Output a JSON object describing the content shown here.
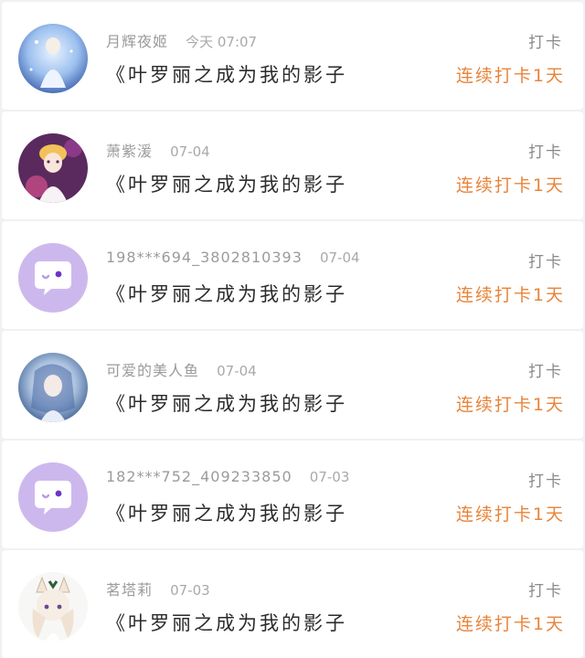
{
  "feed": {
    "items": [
      {
        "username": "月辉夜姬",
        "date": "今天 07:07",
        "book": "《叶罗丽之成为我的影子",
        "action": "打卡",
        "streak": "连续打卡1天",
        "avatar_icon": "user-avatar-fairy"
      },
      {
        "username": "萧紫湲",
        "date": "07-04",
        "book": "《叶罗丽之成为我的影子",
        "action": "打卡",
        "streak": "连续打卡1天",
        "avatar_icon": "user-avatar-doll"
      },
      {
        "username": "198***694_3802810393",
        "date": "07-04",
        "book": "《叶罗丽之成为我的影子",
        "action": "打卡",
        "streak": "连续打卡1天",
        "avatar_icon": "default-chat-avatar-icon"
      },
      {
        "username": "可爱的美人鱼",
        "date": "07-04",
        "book": "《叶罗丽之成为我的影子",
        "action": "打卡",
        "streak": "连续打卡1天",
        "avatar_icon": "user-avatar-mermaid"
      },
      {
        "username": "182***752_409233850",
        "date": "07-03",
        "book": "《叶罗丽之成为我的影子",
        "action": "打卡",
        "streak": "连续打卡1天",
        "avatar_icon": "default-chat-avatar-icon"
      },
      {
        "username": "茗塔莉",
        "date": "07-03",
        "book": "《叶罗丽之成为我的影子",
        "action": "打卡",
        "streak": "连续打卡1天",
        "avatar_icon": "user-avatar-catgirl"
      }
    ]
  },
  "colors": {
    "streak": "#e8843a",
    "default_avatar_bg": "#cdb8ee",
    "page_bg": "#f1f1f3"
  }
}
